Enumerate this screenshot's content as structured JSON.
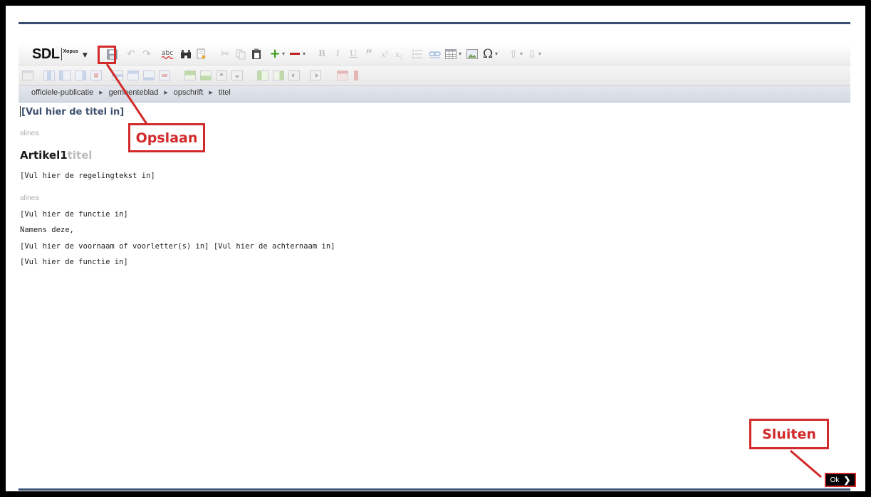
{
  "app": {
    "logo_text": "SDL",
    "logo_sub": "Xopus"
  },
  "toolbar": {
    "icons": [
      "save-icon",
      "undo-icon",
      "redo-icon",
      "spellcheck-icon",
      "find-icon",
      "find-replace-icon",
      "cut-icon",
      "copy-icon",
      "paste-icon",
      "insert-icon",
      "remove-icon",
      "bold-icon",
      "italic-icon",
      "underline-icon",
      "quote-icon",
      "superscript-icon",
      "subscript-icon",
      "list-icon",
      "link-icon",
      "table-icon",
      "image-icon",
      "special-char-icon",
      "move-up-icon",
      "move-down-icon"
    ],
    "bold_label": "B",
    "italic_label": "I",
    "underline_label": "U",
    "omega_label": "Ω"
  },
  "breadcrumb": {
    "items": [
      "officiele-publicatie",
      "gemeenteblad",
      "opschrift",
      "titel"
    ]
  },
  "document": {
    "title": "[Vul hier de titel in]",
    "alinea_1": "alinea",
    "article_label": "Artikel1",
    "article_title_placeholder": "titel",
    "regelingtekst": "[Vul hier de regelingtekst in]",
    "alinea_2": "alinea",
    "functie_1": "[Vul hier de functie in]",
    "namens": "Namens deze,",
    "namen": "[Vul hier de voornaam of voorletter(s) in] [Vul hier de achternaam in]",
    "functie_2": "[Vul hier de functie in]"
  },
  "annotations": {
    "save_callout": "Opslaan",
    "close_callout": "Sluiten",
    "accent_color": "#d22a2a"
  },
  "footer": {
    "ok_label": "Ok",
    "ok_chevron": "❯"
  },
  "colors": {
    "rule": "#3a4f72",
    "title": "#3d4f6e",
    "insert_green": "#3a9a1a",
    "remove_red": "#c42020"
  }
}
